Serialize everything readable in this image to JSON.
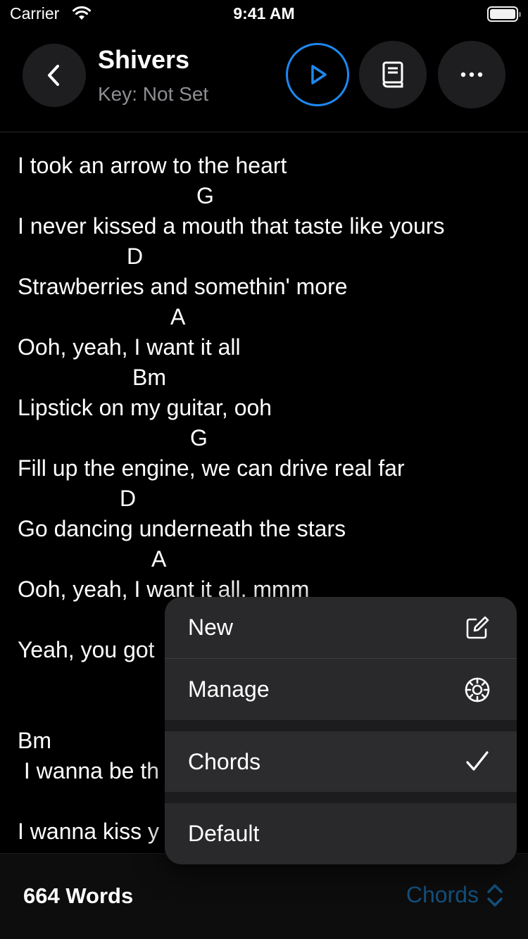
{
  "status_bar": {
    "carrier": "Carrier",
    "time": "9:41 AM"
  },
  "header": {
    "title": "Shivers",
    "subtitle": "Key: Not Set",
    "icons": {
      "back": "chevron-left-icon",
      "play": "play-icon",
      "book": "book-icon",
      "more": "ellipsis-icon"
    },
    "play_color": "#1e88f0"
  },
  "lyrics": {
    "lines": [
      "I took an arrow to the heart",
      "G",
      "I never kissed a mouth that taste like yours",
      "D",
      "Strawberries and somethin' more",
      "A",
      "Ooh, yeah, I want it all",
      "Bm",
      "Lipstick on my guitar, ooh",
      "G",
      "Fill up the engine, we can drive real far",
      "D",
      "Go dancing underneath the stars",
      "A",
      "Ooh, yeah, I want it all, mmm",
      "Yeah, you got",
      "Bm",
      " I wanna be th",
      "I wanna kiss y"
    ]
  },
  "menu": {
    "items": [
      {
        "label": "New",
        "icon": "compose-icon"
      },
      {
        "label": "Manage",
        "icon": "gear-icon"
      },
      {
        "label": "Chords",
        "icon": "checkmark-icon",
        "checked": true
      },
      {
        "label": "Default"
      }
    ]
  },
  "bottom_bar": {
    "word_count": "664 Words",
    "mode": "Chords",
    "mode_icon": "chevron-up-down-icon",
    "mode_color": "#13507e"
  }
}
